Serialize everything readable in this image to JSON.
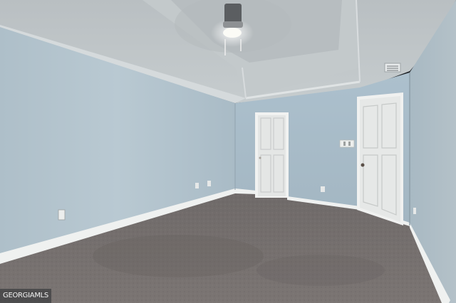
{
  "scene": {
    "kind": "empty bedroom interior",
    "elements": [
      "tray-ceiling",
      "ceiling-fan-light",
      "hvac-vent",
      "left-wall",
      "back-wall",
      "right-wall",
      "closet-door",
      "entry-door",
      "light-switch-plate",
      "wall-outlets",
      "baseboards",
      "carpet-floor"
    ]
  },
  "watermark": {
    "text": "GEORGIAMLS"
  },
  "colors": {
    "wall": "#b2c2cc",
    "ceiling": "#c9cfd2",
    "carpet": "#77716f",
    "trim": "#eef0ef",
    "door": "#e6e8e7"
  }
}
